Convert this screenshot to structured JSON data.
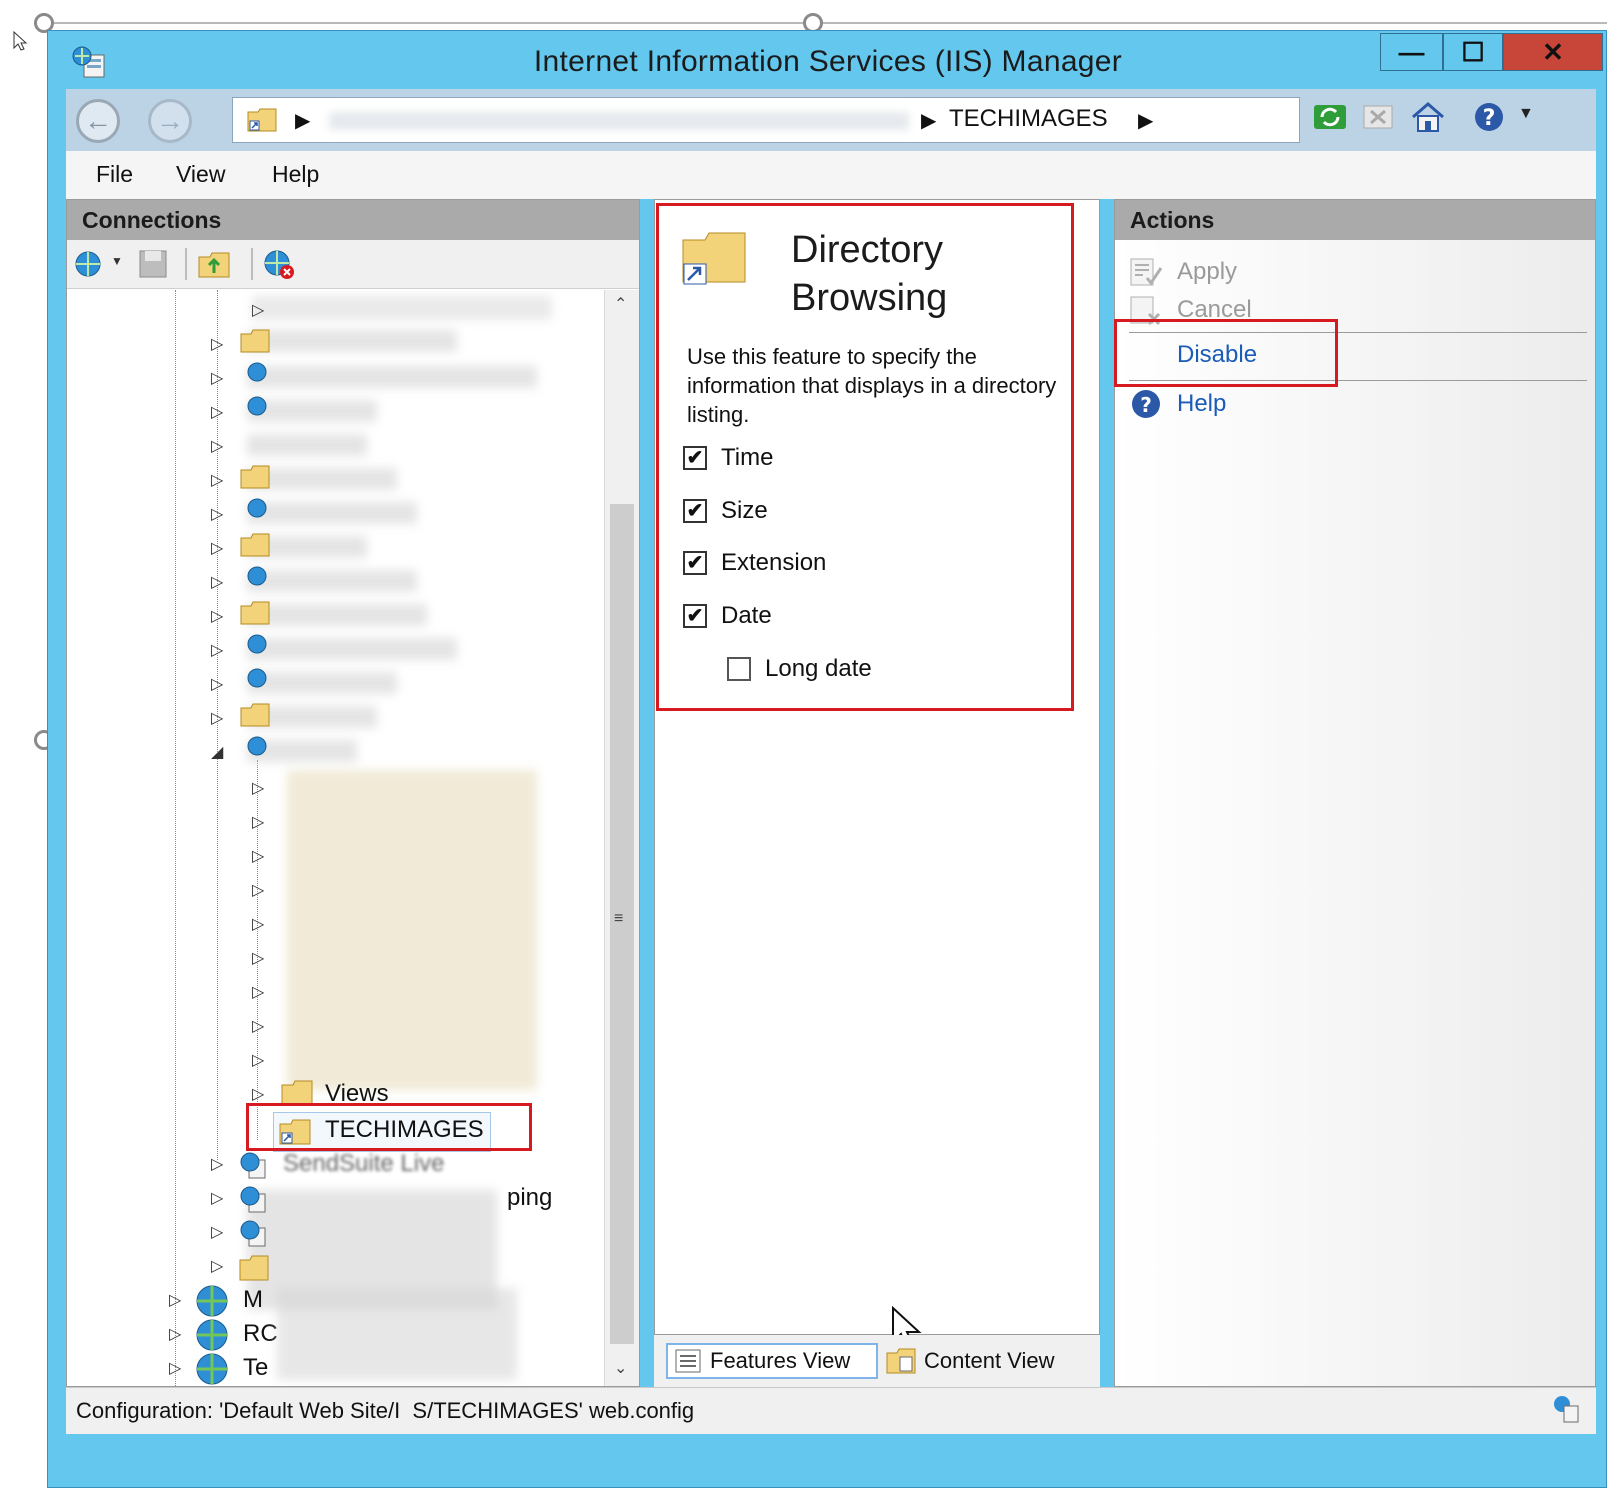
{
  "window": {
    "title": "Internet Information Services (IIS) Manager",
    "controls": {
      "minimize": "—",
      "maximize": "☐",
      "close": "✕"
    }
  },
  "address": {
    "arrow": "▶",
    "current": "TECHIMAGES"
  },
  "menu": [
    "File",
    "View",
    "Help"
  ],
  "connections": {
    "header": "Connections",
    "tree": {
      "visible_items": [
        "Views",
        "TECHIMAGES",
        "SendSuite Live",
        "ping",
        "M",
        "RC",
        "Te"
      ],
      "selected": "TECHIMAGES"
    }
  },
  "feature": {
    "title_line1": "Directory",
    "title_line2": "Browsing",
    "description": "Use this feature to specify the information that displays in a directory listing.",
    "options": [
      {
        "label": "Time",
        "checked": true
      },
      {
        "label": "Size",
        "checked": true
      },
      {
        "label": "Extension",
        "checked": true
      },
      {
        "label": "Date",
        "checked": true
      },
      {
        "label": "Long date",
        "checked": false
      }
    ],
    "check_glyph": "✔"
  },
  "views": {
    "features": "Features View",
    "content": "Content View"
  },
  "actions": {
    "header": "Actions",
    "apply": "Apply",
    "cancel": "Cancel",
    "disable": "Disable",
    "help": "Help"
  },
  "status": {
    "text": "Configuration: 'Default Web Site/I  S/TECHIMAGES' web.config"
  },
  "colors": {
    "title_bar": "#63c7ee",
    "close_button": "#c74639",
    "highlight_box": "#d71920",
    "link_blue": "#1a5cb8",
    "pane_header": "#aaaaaa"
  },
  "icons": {
    "app": "iis-manager-icon",
    "address_folder": "folder-shortcut-icon",
    "toolbar": [
      "refresh-icon",
      "stop-icon",
      "home-icon",
      "help-icon"
    ],
    "connections_toolbar": [
      "connect-icon",
      "save-icon",
      "folder-up-icon",
      "disconnect-icon"
    ]
  }
}
